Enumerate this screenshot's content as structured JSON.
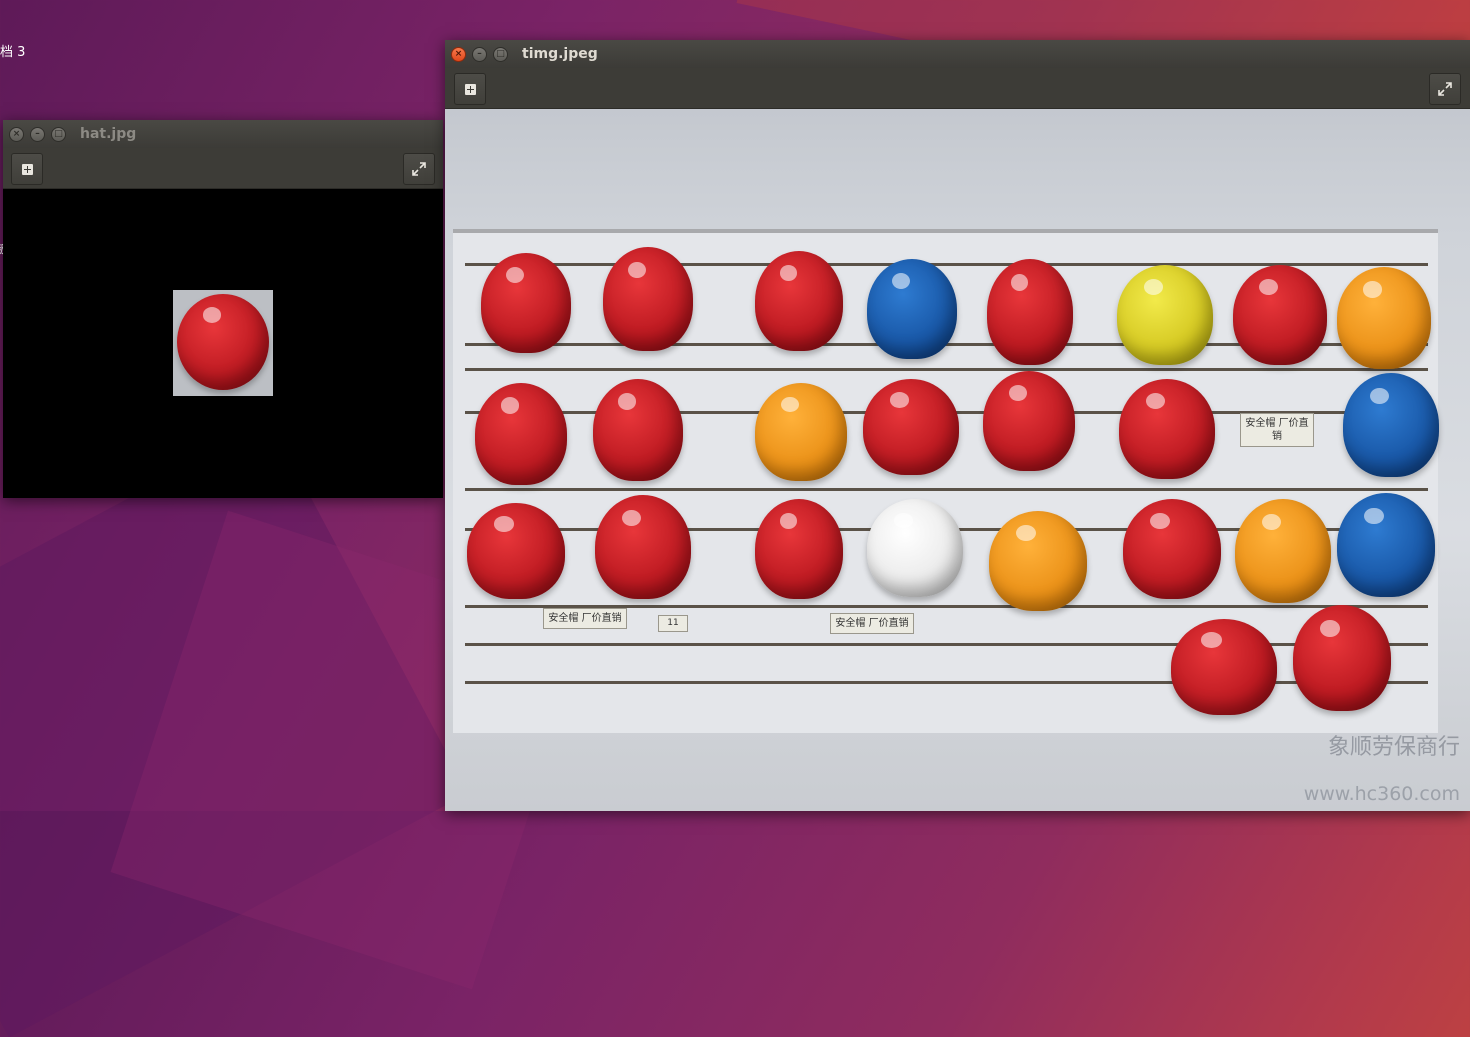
{
  "desktop": {
    "labels": [
      "档 3",
      "被"
    ]
  },
  "windows": {
    "hat": {
      "title": "hat.jpg",
      "toolbar": {
        "add_icon": "add-icon",
        "fullscreen_icon": "fullscreen-icon"
      }
    },
    "timg": {
      "title": "timg.jpeg",
      "toolbar": {
        "add_icon": "add-icon",
        "fullscreen_icon": "fullscreen-icon"
      },
      "signs": [
        "安全帽 厂价直销",
        "11",
        "安全帽 厂价直销",
        "安全帽 厂价直销"
      ],
      "watermark_name": "象顺劳保商行",
      "watermark_url": "www.hc360.com"
    }
  },
  "window_buttons": {
    "close": "×",
    "minimize": "–",
    "maximize": "□"
  },
  "colors": {
    "close_active": "#e0481c",
    "titlebar": "#3c3b37",
    "desktop_start": "#5e1a58",
    "desktop_end": "#d2502f"
  }
}
